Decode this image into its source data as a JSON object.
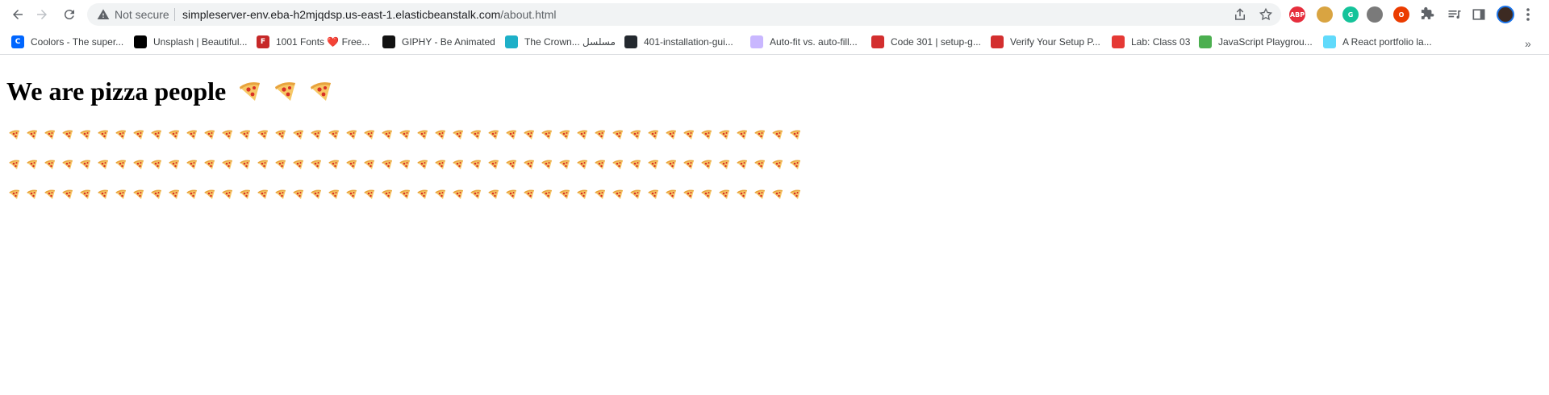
{
  "browser": {
    "security_label": "Not secure",
    "url_host": "simpleserver-env.eba-h2mjqdsp.us-east-1.elasticbeanstalk.com",
    "url_path": "/about.html"
  },
  "extensions": [
    {
      "name": "adblock-icon",
      "text": "ABP",
      "color": "#e62e3d"
    },
    {
      "name": "cookie-icon",
      "text": "",
      "color": "#d9a441"
    },
    {
      "name": "grammarly-icon",
      "text": "G",
      "color": "#15c39a"
    },
    {
      "name": "helmet-icon",
      "text": "",
      "color": "#7a7a7a"
    },
    {
      "name": "office-icon",
      "text": "O",
      "color": "#eb3c00"
    }
  ],
  "bookmarks": [
    {
      "label": "Coolors - The super...",
      "icon": "coolors-icon",
      "color": "#0066ff",
      "glyph": "C"
    },
    {
      "label": "Unsplash | Beautiful...",
      "icon": "unsplash-icon",
      "color": "#000000",
      "glyph": ""
    },
    {
      "label": "1001 Fonts ❤️ Free...",
      "icon": "fonts-icon",
      "color": "#c62828",
      "glyph": "F"
    },
    {
      "label": "GIPHY - Be Animated",
      "icon": "giphy-icon",
      "color": "#121212",
      "glyph": ""
    },
    {
      "label": "The Crown... مسلسل",
      "icon": "location-icon",
      "color": "#1eb0c8",
      "glyph": ""
    },
    {
      "label": "401-installation-gui...",
      "icon": "github-icon",
      "color": "#24292f",
      "glyph": ""
    },
    {
      "label": "Auto-fit vs. auto-fill...",
      "icon": "css-tricks-icon",
      "color": "#c9b7ff",
      "glyph": ""
    },
    {
      "label": "Code 301 | setup-g...",
      "icon": "codefellows-icon",
      "color": "#d32f2f",
      "glyph": ""
    },
    {
      "label": "Verify Your Setup P...",
      "icon": "codefellows-icon",
      "color": "#d32f2f",
      "glyph": ""
    },
    {
      "label": "Lab: Class 03",
      "icon": "lab-icon",
      "color": "#e53935",
      "glyph": ""
    },
    {
      "label": "JavaScript Playgrou...",
      "icon": "playground-icon",
      "color": "#4caf50",
      "glyph": ""
    },
    {
      "label": "A React portfolio la...",
      "icon": "react-icon",
      "color": "#61dafb",
      "glyph": ""
    }
  ],
  "page": {
    "heading": "We are pizza people",
    "heading_pizza_count": 3,
    "row_count": 3,
    "pizzas_per_row": 45
  },
  "colors": {
    "crust": "#e8a33d",
    "cheese": "#f6c766",
    "pepperoni": "#d93025"
  }
}
